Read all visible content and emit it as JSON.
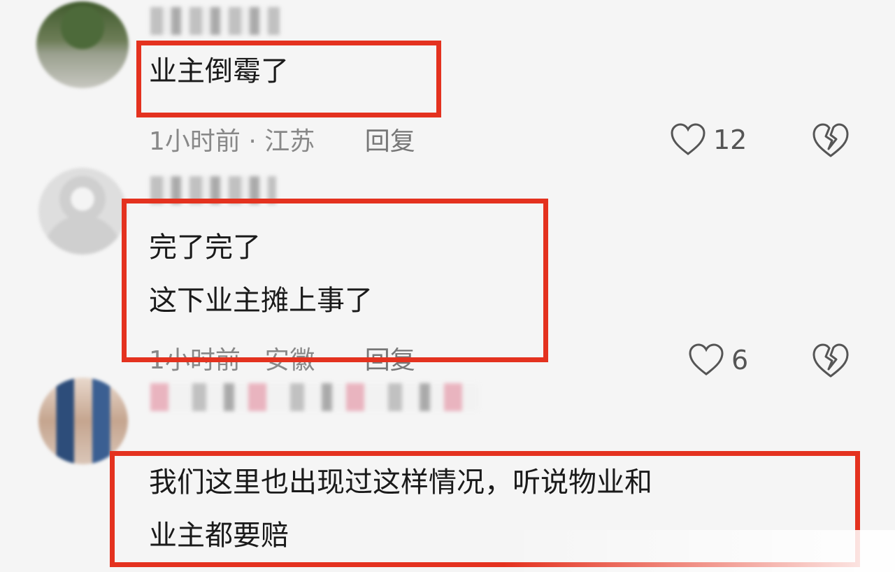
{
  "colors": {
    "highlight": "#e4321f",
    "meta": "#888888",
    "text": "#1a1a1a"
  },
  "comments": [
    {
      "text_lines": [
        "业主倒霉了"
      ],
      "time": "1小时前",
      "location": "江苏",
      "separator": "·",
      "reply_label": "回复",
      "like_count": "12",
      "like_icon": "heart-icon",
      "dislike_icon": "broken-heart-icon"
    },
    {
      "text_lines": [
        "完了完了",
        "这下业主摊上事了"
      ],
      "time": "1小时前",
      "location": "安徽",
      "separator": "·",
      "reply_label": "回复",
      "like_count": "6",
      "like_icon": "heart-icon",
      "dislike_icon": "broken-heart-icon"
    },
    {
      "text_lines": [
        "我们这里也出现过这样情况，听说物业和",
        "业主都要赔"
      ]
    }
  ]
}
